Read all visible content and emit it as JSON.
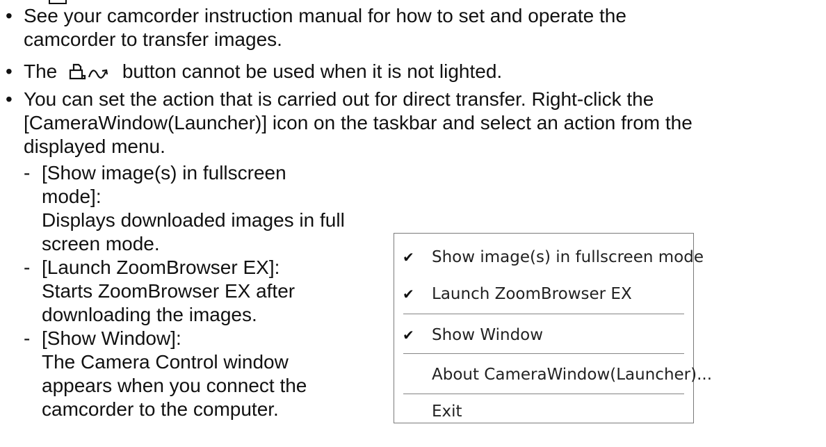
{
  "bullets": [
    {
      "symbol": "•",
      "text": "See your camcorder instruction manual for how to set and operate the camcorder to transfer images."
    },
    {
      "symbol": "•",
      "before": "The",
      "after": "button cannot be used when it is not lighted."
    },
    {
      "symbol": "•",
      "text": "You can set the action that is carried out for direct transfer. Right-click the [CameraWindow(Launcher)] icon on the taskbar and select an action from the displayed menu."
    }
  ],
  "sub_items": [
    {
      "dash": "-",
      "title": "[Show image(s) in fullscreen mode]:",
      "description": "Displays downloaded images in full screen mode."
    },
    {
      "dash": "-",
      "title": "[Launch ZoomBrowser EX]:",
      "description": "Starts ZoomBrowser EX after downloading the images."
    },
    {
      "dash": "-",
      "title": "[Show Window]:",
      "description": "The Camera Control window appears when you connect the camcorder to the computer."
    }
  ],
  "context_menu": {
    "check_glyph": "✔",
    "items": [
      {
        "label": "Show image(s) in fullscreen mode",
        "checked": true
      },
      {
        "label": "Launch ZoomBrowser EX",
        "checked": true
      },
      {
        "label": "Show Window",
        "checked": true
      },
      {
        "label": "About CameraWindow(Launcher)...",
        "checked": false
      },
      {
        "label": "Exit",
        "checked": false
      }
    ]
  },
  "icons": {
    "button_icons": [
      "print-icon",
      "share-icon"
    ]
  }
}
